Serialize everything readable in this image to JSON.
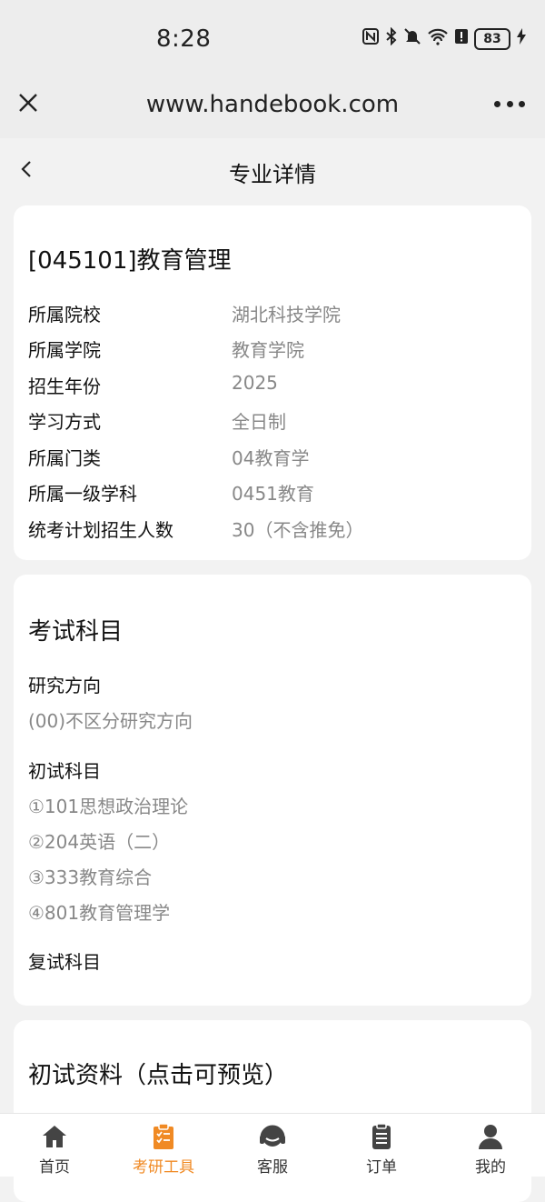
{
  "status": {
    "time": "8:28",
    "battery": "83"
  },
  "browser": {
    "url": "www.handebook.com"
  },
  "header": {
    "title": "专业详情"
  },
  "major": {
    "title": "[045101]教育管理",
    "info": [
      {
        "label": "所属院校",
        "value": "湖北科技学院"
      },
      {
        "label": "所属学院",
        "value": "教育学院"
      },
      {
        "label": "招生年份",
        "value": "2025"
      },
      {
        "label": "学习方式",
        "value": "全日制"
      },
      {
        "label": "所属门类",
        "value": "04教育学"
      },
      {
        "label": "所属一级学科",
        "value": "0451教育"
      },
      {
        "label": "统考计划招生人数",
        "value": "30（不含推免）"
      }
    ]
  },
  "exam": {
    "title": "考试科目",
    "direction_label": "研究方向",
    "direction_value": "(00)不区分研究方向",
    "preliminary_label": "初试科目",
    "preliminary_items": [
      "①101思想政治理论",
      "②204英语（二）",
      "③333教育综合",
      "④801教育管理学"
    ],
    "retest_label": "复试科目"
  },
  "materials": {
    "title": "初试资料（点击可预览）"
  },
  "tabbar": {
    "items": [
      {
        "label": "首页",
        "icon": "home-icon"
      },
      {
        "label": "考研工具",
        "icon": "clipboard-icon"
      },
      {
        "label": "客服",
        "icon": "headset-icon"
      },
      {
        "label": "订单",
        "icon": "order-icon"
      },
      {
        "label": "我的",
        "icon": "user-icon"
      }
    ],
    "active_color": "#f08a24",
    "inactive_color": "#333333"
  }
}
